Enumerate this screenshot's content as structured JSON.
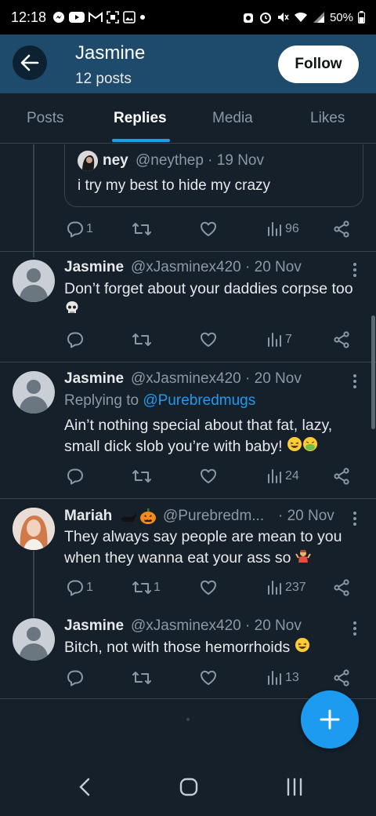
{
  "status_bar": {
    "time": "12:18",
    "battery": "50%",
    "left_icons": [
      "messenger-icon",
      "youtube-icon",
      "gmail-icon",
      "screenshot-icon",
      "gallery-icon"
    ],
    "right_icons": [
      "alarm-icon",
      "mute-icon",
      "wifi-icon",
      "signal-icon",
      "battery-icon"
    ]
  },
  "header": {
    "name": "Jasmine",
    "posts_count": "12 posts",
    "follow_label": "Follow",
    "background": "#1e4a6b"
  },
  "tabs": [
    {
      "label": "Posts",
      "active": false
    },
    {
      "label": "Replies",
      "active": true
    },
    {
      "label": "Media",
      "active": false
    },
    {
      "label": "Likes",
      "active": false
    }
  ],
  "quoted_tweet": {
    "name": "ney",
    "handle_date": "@neythep · 19 Nov",
    "text": "i try my best to hide my crazy",
    "actions": {
      "replies": "1",
      "retweets": "",
      "views": "96"
    }
  },
  "tweets": [
    {
      "name": "Jasmine",
      "handle_date": "@xJasminex420 · 20 Nov",
      "text": "Don’t forget about your daddies corpse too",
      "emoji": "skull",
      "actions": {
        "replies": "",
        "retweets": "",
        "views": "7"
      }
    },
    {
      "name": "Jasmine",
      "handle_date": "@xJasminex420 · 20 Nov",
      "replying_to_prefix": "Replying to",
      "replying_to": "@Purebredmugs",
      "text": "Ain’t nothing special about that fat, lazy, small dick slob you’re with baby!",
      "emoji": "laughing, nauseated",
      "actions": {
        "replies": "",
        "retweets": "",
        "views": "24"
      }
    },
    {
      "name": "Mariah",
      "handle": "@Purebredm...",
      "date": "· 20 Nov",
      "text": "They always say people are mean to you when they wanna eat your ass so",
      "emoji": "shrug",
      "actions": {
        "replies": "1",
        "retweets": "1",
        "views": "237"
      }
    },
    {
      "name": "Jasmine",
      "handle_date": "@xJasminex420 · 20 Nov",
      "text": "Bitch, not with those hemorrhoids",
      "emoji": "laughing",
      "actions": {
        "replies": "",
        "retweets": "",
        "views": "13"
      }
    }
  ],
  "colors": {
    "background": "#15202b",
    "accent": "#1d9bf0",
    "muted": "#8b98a5",
    "border": "#38444d"
  }
}
